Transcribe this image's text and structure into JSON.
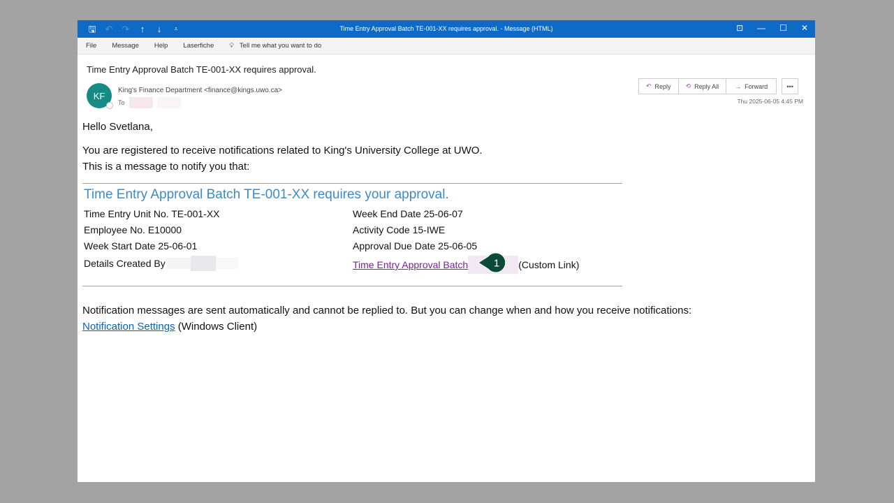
{
  "window": {
    "title": "Time Entry Approval Batch TE-001-XX requires approval.  -  Message (HTML)"
  },
  "menu": [
    "File",
    "Message",
    "Help",
    "Laserfiche"
  ],
  "tell_me": "Tell me what you want to do",
  "email": {
    "subject": "Time Entry Approval Batch TE-001-XX requires approval.",
    "avatar_initials": "KF",
    "sender": "King's Finance Department <finance@kings.uwo.ca>",
    "to_label": "To",
    "date": "Thu 2025-06-05 4:45 PM",
    "actions": {
      "reply": "Reply",
      "reply_all": "Reply All",
      "forward": "Forward",
      "more": "•••"
    },
    "greeting": "Hello Svetlana,",
    "intro1": "You are registered to receive notifications related to King's University College at UWO.",
    "intro2": "This is a message to notify you that:",
    "notice_title": "Time Entry Approval Batch TE-001-XX requires your approval.",
    "left": [
      "Time Entry Unit No. TE-001-XX",
      "Employee No. E10000",
      "Week Start Date 25-06-01",
      "Details Created By"
    ],
    "right": [
      "Week End Date 25-06-07",
      "Activity Code 15-IWE",
      "Approval Due Date 25-06-05"
    ],
    "link": "Time Entry Approval Batch",
    "link_suffix": "(Custom Link)",
    "footer": "Notification messages are sent automatically and cannot be replied to. But you can change when and how you receive notifications:",
    "settings_link": "Notification Settings",
    "settings_suffix": "(Windows Client)"
  },
  "marker": {
    "number": "1",
    "color": "#0b4a38"
  }
}
